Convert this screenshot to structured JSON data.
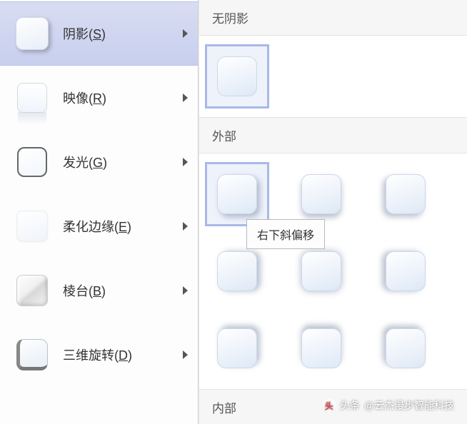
{
  "menu": {
    "items": [
      {
        "label": "阴影",
        "key": "S",
        "selected": true
      },
      {
        "label": "映像",
        "key": "R",
        "selected": false
      },
      {
        "label": "发光",
        "key": "G",
        "selected": false
      },
      {
        "label": "柔化边缘",
        "key": "E",
        "selected": false
      },
      {
        "label": "棱台",
        "key": "B",
        "selected": false
      },
      {
        "label": "三维旋转",
        "key": "D",
        "selected": false
      }
    ]
  },
  "gallery": {
    "sections": [
      {
        "title": "无阴影",
        "presets": [
          {
            "id": "none",
            "selected": true
          }
        ]
      },
      {
        "title": "外部",
        "presets": [
          {
            "id": "outer-1",
            "selected": true
          },
          {
            "id": "outer-2",
            "selected": false
          },
          {
            "id": "outer-3",
            "selected": false
          },
          {
            "id": "outer-4",
            "selected": false
          },
          {
            "id": "outer-5",
            "selected": false
          },
          {
            "id": "outer-6",
            "selected": false
          },
          {
            "id": "outer-7",
            "selected": false
          },
          {
            "id": "outer-8",
            "selected": false
          },
          {
            "id": "outer-9",
            "selected": false
          }
        ]
      },
      {
        "title": "内部",
        "presets": []
      }
    ]
  },
  "tooltip": {
    "text": "右下斜偏移"
  },
  "watermark": {
    "prefix": "头条",
    "text": "@云杰漫步智能科技"
  }
}
